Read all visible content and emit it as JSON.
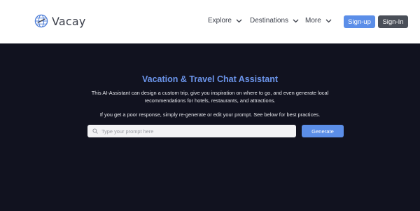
{
  "header": {
    "brand": "Vacay",
    "nav": [
      {
        "label": "Explore",
        "icon": "chevron-down-icon"
      },
      {
        "label": "Destinations",
        "icon": "chevron-down-icon"
      },
      {
        "label": "More",
        "icon": "chevron-down-icon"
      }
    ],
    "signup_label": "Sign-up",
    "signin_label": "Sign-In"
  },
  "main": {
    "title": "Vacation & Travel Chat Assistant",
    "description": "This AI-Assistant can design a custom trip, give you inspiration on where to go, and even generate local recommendations for hotels, restaurants, and attractions.",
    "tip": "If you get a poor response, simply re-generate or edit your prompt. See below for best practices.",
    "prompt_placeholder": "Type your prompt here",
    "generate_label": "Generate"
  },
  "colors": {
    "accent": "#5b8ee8",
    "title": "#6b94ea",
    "background": "#11121f",
    "signin": "#4a4f58"
  }
}
